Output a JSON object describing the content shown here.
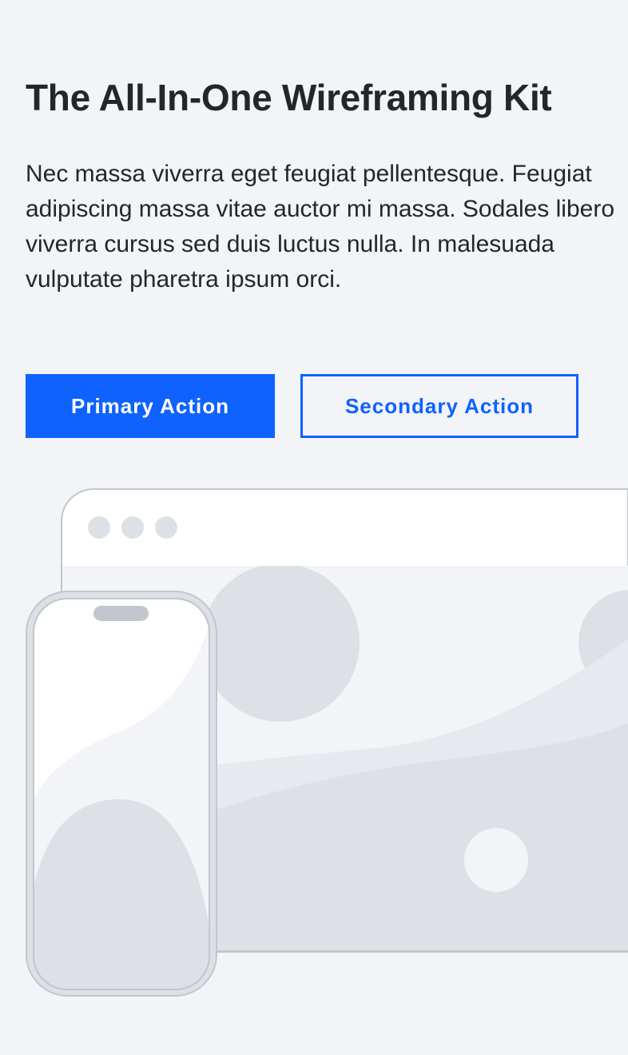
{
  "hero": {
    "title": "The All-In-One Wireframing Kit",
    "body": "Nec massa viverra eget feugiat pellentesque. Feugiat adipiscing massa vitae auctor mi massa. Sodales libero viverra cursus sed duis luctus nulla. In malesuada vulputate pharetra ipsum orci."
  },
  "actions": {
    "primary_label": "Primary Action",
    "secondary_label": "Secondary Action"
  },
  "colors": {
    "background": "#f2f4f8",
    "text": "#21272a",
    "accent": "#0f62fe",
    "illustration_fill": "#dde1e6",
    "illustration_stroke": "#c1c7cd"
  },
  "illustration": {
    "browser_dots": [
      "dot",
      "dot",
      "dot"
    ],
    "description_icon": "browser-and-phone-mockup"
  }
}
